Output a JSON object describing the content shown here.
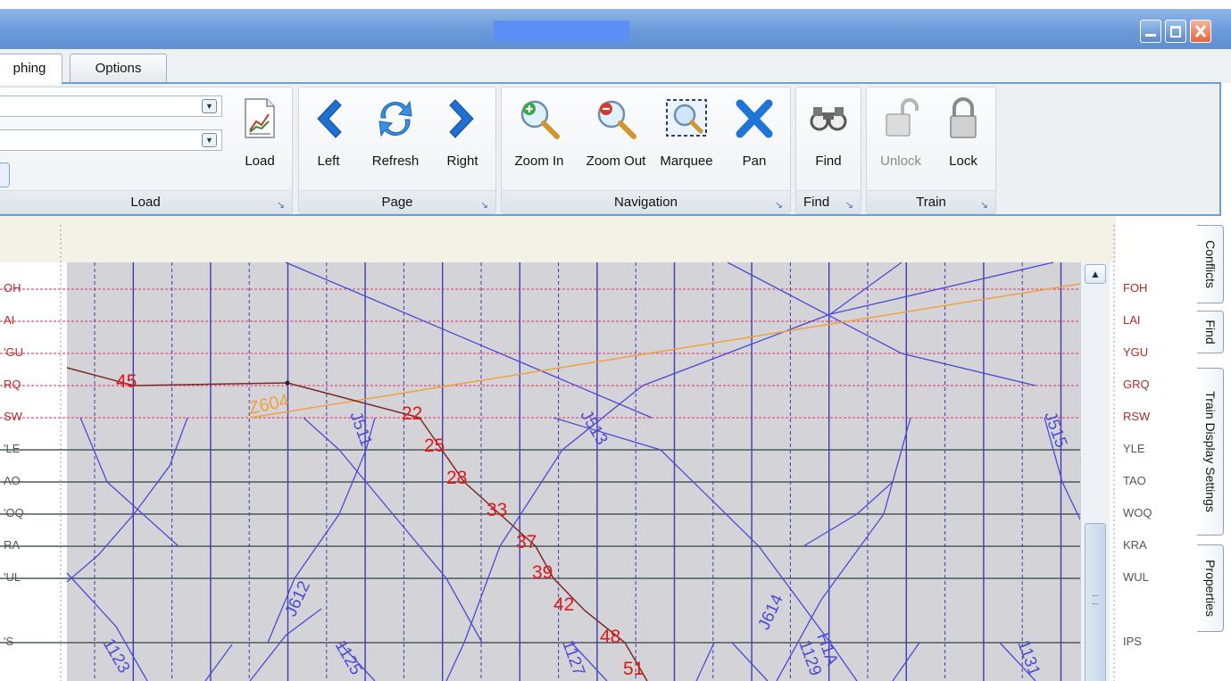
{
  "window": {
    "tabs": [
      {
        "label": "phing",
        "active": true
      },
      {
        "label": "Options",
        "active": false
      }
    ]
  },
  "ribbon": {
    "groups": {
      "load": {
        "label": "Load",
        "load_label": "Load"
      },
      "page": {
        "label": "Page",
        "left_label": "Left",
        "refresh_label": "Refresh",
        "right_label": "Right"
      },
      "navigation": {
        "label": "Navigation",
        "zoom_in_label": "Zoom In",
        "zoom_out_label": "Zoom Out",
        "marquee_label": "Marquee",
        "pan_label": "Pan"
      },
      "find": {
        "label": "Find",
        "find_label": "Find"
      },
      "train": {
        "label": "Train",
        "unlock_label": "Unlock",
        "lock_label": "Lock"
      }
    }
  },
  "graph": {
    "stations_left": [
      "OH",
      "AI",
      "'GU",
      "RQ",
      "SW",
      "'LE",
      "AO",
      "'OQ",
      "RA",
      "'UL",
      "'S"
    ],
    "stations_right": [
      "FOH",
      "LAI",
      "YGU",
      "GRQ",
      "RSW",
      "YLE",
      "TAO",
      "WOQ",
      "KRA",
      "WUL",
      "IPS"
    ],
    "trains": [
      {
        "id": "Z604"
      },
      {
        "id": "J511"
      },
      {
        "id": "J513"
      },
      {
        "id": "J515"
      },
      {
        "id": "J612"
      },
      {
        "id": "J614"
      },
      {
        "id": "1123"
      },
      {
        "id": "1125"
      },
      {
        "id": "1127"
      },
      {
        "id": "1129"
      },
      {
        "id": "1131"
      },
      {
        "id": "H1A"
      }
    ],
    "markers": [
      "45",
      "22",
      "25",
      "28",
      "33",
      "37",
      "39",
      "42",
      "48",
      "51"
    ]
  },
  "sidetabs": [
    "Conflicts",
    "Find",
    "Train Display Settings",
    "Properties"
  ],
  "colors": {
    "grid_line": "#3d3db0",
    "train_line": "#4b4bd6",
    "orange_train": "#f0a040",
    "selected_train": "#7a2a2a",
    "marker_text": "#e01818",
    "station_text": "#b02a2a",
    "plot_bg": "#d4d4d8"
  }
}
